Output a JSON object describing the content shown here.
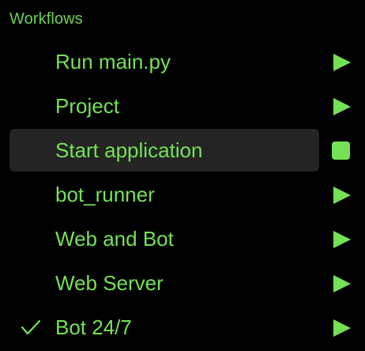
{
  "section": {
    "title": "Workflows"
  },
  "colors": {
    "accent": "#74e256",
    "selected_bg": "#242424",
    "background": "#000000"
  },
  "workflows": [
    {
      "label": "Run main.py",
      "action_icon": "play-icon",
      "running": false,
      "checked": false
    },
    {
      "label": "Project",
      "action_icon": "play-icon",
      "running": false,
      "checked": false
    },
    {
      "label": "Start application",
      "action_icon": "stop-icon",
      "running": true,
      "checked": false,
      "selected": true
    },
    {
      "label": "bot_runner",
      "action_icon": "play-icon",
      "running": false,
      "checked": false
    },
    {
      "label": "Web and Bot",
      "action_icon": "play-icon",
      "running": false,
      "checked": false
    },
    {
      "label": "Web Server",
      "action_icon": "play-icon",
      "running": false,
      "checked": false
    },
    {
      "label": "Bot 24/7",
      "action_icon": "play-icon",
      "running": false,
      "checked": true
    }
  ]
}
